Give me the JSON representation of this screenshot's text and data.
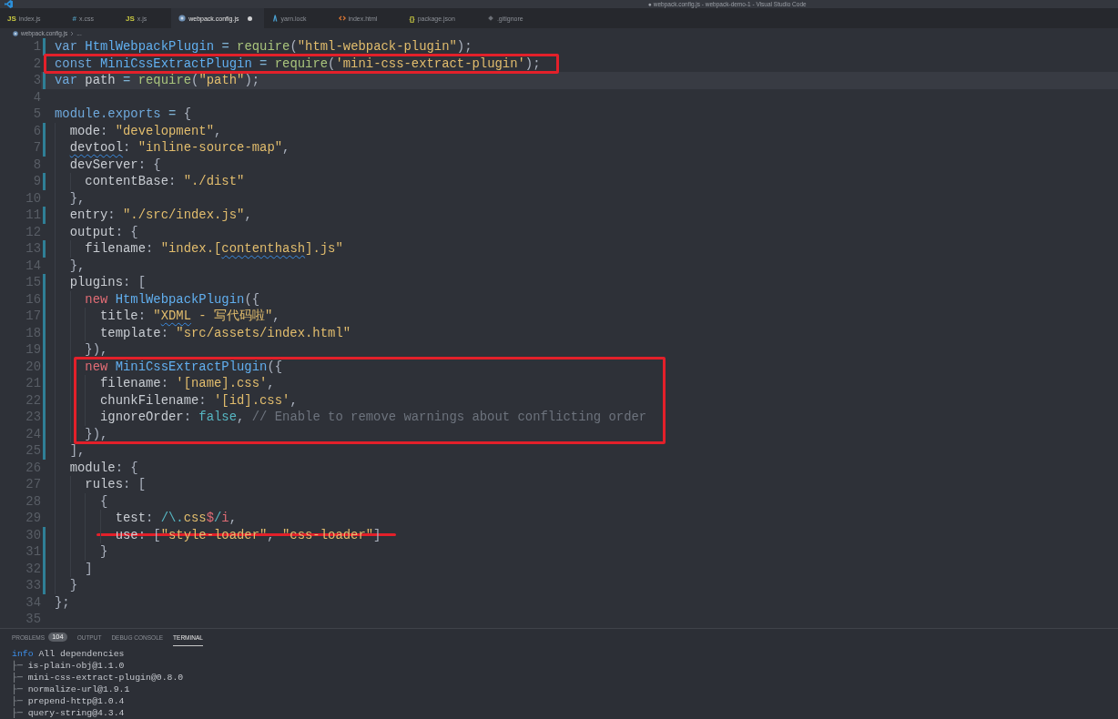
{
  "window": {
    "title": "● webpack.config.js - webpack-demo-1 - Visual Studio Code"
  },
  "tabs": [
    {
      "label": "index.js",
      "kind": "js",
      "glyph": "JS",
      "selected": false,
      "modified": false
    },
    {
      "label": "x.css",
      "kind": "css",
      "glyph": "#",
      "selected": false,
      "modified": false
    },
    {
      "label": "x.js",
      "kind": "js",
      "glyph": "JS",
      "selected": false,
      "modified": false
    },
    {
      "label": "webpack.config.js",
      "kind": "config",
      "selected": true,
      "modified": true
    },
    {
      "label": "yarn.lock",
      "kind": "yarn",
      "selected": false,
      "modified": false
    },
    {
      "label": "index.html",
      "kind": "html",
      "selected": false,
      "modified": false
    },
    {
      "label": "package.json",
      "kind": "json",
      "glyph": "{}",
      "selected": false,
      "modified": false
    },
    {
      "label": ".gitignore",
      "kind": "git",
      "selected": false,
      "modified": false
    }
  ],
  "breadcrumb": {
    "kind": "config",
    "items": [
      "webpack.config.js",
      "..."
    ]
  },
  "lines": [
    {
      "n": "1",
      "changed": true,
      "current": false,
      "boxed": false,
      "struck": false,
      "code": [
        {
          "text": "var ",
          "kind": "decl"
        },
        {
          "text": "HtmlWebpackPlugin",
          "kind": "class"
        },
        {
          "text": " = ",
          "kind": "op"
        },
        {
          "text": "require",
          "kind": "fn"
        },
        {
          "text": "(",
          "kind": "punc"
        },
        {
          "text": "\"html-webpack-plugin\"",
          "kind": "str"
        },
        {
          "text": ");",
          "kind": "punc"
        }
      ]
    },
    {
      "n": "2",
      "changed": false,
      "current": false,
      "boxed": true,
      "struck": false,
      "code": [
        {
          "text": "const ",
          "kind": "decl"
        },
        {
          "text": "MiniCssExtractPlugin",
          "kind": "class"
        },
        {
          "text": " = ",
          "kind": "op"
        },
        {
          "text": "require",
          "kind": "fn"
        },
        {
          "text": "(",
          "kind": "punc"
        },
        {
          "text": "'mini-css-extract-plugin'",
          "kind": "str"
        },
        {
          "text": ");",
          "kind": "punc"
        }
      ]
    },
    {
      "n": "3",
      "changed": true,
      "current": true,
      "boxed": false,
      "struck": false,
      "code": [
        {
          "text": "var ",
          "kind": "decl"
        },
        {
          "text": "path",
          "kind": "plain"
        },
        {
          "text": " = ",
          "kind": "op"
        },
        {
          "text": "require",
          "kind": "fn"
        },
        {
          "text": "(",
          "kind": "punc"
        },
        {
          "text": "\"path\"",
          "kind": "str"
        },
        {
          "text": ");",
          "kind": "punc"
        }
      ]
    },
    {
      "n": "4",
      "changed": false,
      "current": false,
      "boxed": false,
      "struck": false
    },
    {
      "n": "5",
      "changed": false,
      "current": false,
      "boxed": false,
      "struck": false,
      "code": [
        {
          "text": "module.exports",
          "kind": "obj"
        },
        {
          "text": " = ",
          "kind": "op"
        },
        {
          "text": "{",
          "kind": "punc"
        }
      ]
    },
    {
      "n": "6",
      "changed": true,
      "current": false,
      "boxed": false,
      "struck": false,
      "code": [
        {
          "text": "  mode",
          "kind": "prop"
        },
        {
          "text": ": ",
          "kind": "punc"
        },
        {
          "text": "\"development\"",
          "kind": "str"
        },
        {
          "text": ",",
          "kind": "punc"
        }
      ]
    },
    {
      "n": "7",
      "changed": true,
      "current": false,
      "boxed": false,
      "struck": false,
      "code": [
        {
          "text": "  devtool",
          "kind": "prop",
          "squiggle": true
        },
        {
          "text": ": ",
          "kind": "punc"
        },
        {
          "text": "\"inline-source-map\"",
          "kind": "str"
        },
        {
          "text": ",",
          "kind": "punc"
        }
      ]
    },
    {
      "n": "8",
      "changed": false,
      "current": false,
      "boxed": false,
      "struck": false,
      "code": [
        {
          "text": "  devServer",
          "kind": "prop"
        },
        {
          "text": ": {",
          "kind": "punc"
        }
      ]
    },
    {
      "n": "9",
      "changed": true,
      "current": false,
      "boxed": false,
      "struck": false,
      "code": [
        {
          "text": "    contentBase",
          "kind": "prop"
        },
        {
          "text": ": ",
          "kind": "punc"
        },
        {
          "text": "\"./dist\"",
          "kind": "str"
        }
      ]
    },
    {
      "n": "10",
      "changed": false,
      "current": false,
      "boxed": false,
      "struck": false,
      "code": [
        {
          "text": "  },",
          "kind": "punc"
        }
      ]
    },
    {
      "n": "11",
      "changed": true,
      "current": false,
      "boxed": false,
      "struck": false,
      "code": [
        {
          "text": "  entry",
          "kind": "prop"
        },
        {
          "text": ": ",
          "kind": "punc"
        },
        {
          "text": "\"./src/index.js\"",
          "kind": "str"
        },
        {
          "text": ",",
          "kind": "punc"
        }
      ]
    },
    {
      "n": "12",
      "changed": false,
      "current": false,
      "boxed": false,
      "struck": false,
      "code": [
        {
          "text": "  output",
          "kind": "prop"
        },
        {
          "text": ": {",
          "kind": "punc"
        }
      ]
    },
    {
      "n": "13",
      "changed": true,
      "current": false,
      "boxed": false,
      "struck": false,
      "code": [
        {
          "text": "    filename",
          "kind": "prop"
        },
        {
          "text": ": ",
          "kind": "punc"
        },
        {
          "text": "\"index.[",
          "kind": "str"
        },
        {
          "text": "contenthash",
          "kind": "str",
          "squiggle": true
        },
        {
          "text": "].js\"",
          "kind": "str"
        }
      ]
    },
    {
      "n": "14",
      "changed": false,
      "current": false,
      "boxed": false,
      "struck": false,
      "code": [
        {
          "text": "  },",
          "kind": "punc"
        }
      ]
    },
    {
      "n": "15",
      "changed": true,
      "current": false,
      "boxed": false,
      "struck": false,
      "code": [
        {
          "text": "  plugins",
          "kind": "prop"
        },
        {
          "text": ": [",
          "kind": "punc"
        }
      ]
    },
    {
      "n": "16",
      "changed": true,
      "current": false,
      "boxed": false,
      "struck": false,
      "code": [
        {
          "text": "    new ",
          "kind": "new"
        },
        {
          "text": "HtmlWebpackPlugin",
          "kind": "class"
        },
        {
          "text": "({",
          "kind": "punc"
        }
      ]
    },
    {
      "n": "17",
      "changed": true,
      "current": false,
      "boxed": false,
      "struck": false,
      "code": [
        {
          "text": "      title",
          "kind": "prop"
        },
        {
          "text": ": ",
          "kind": "punc"
        },
        {
          "text": "\"",
          "kind": "str"
        },
        {
          "text": "XDML",
          "kind": "str",
          "squiggle": true
        },
        {
          "text": " - 写代码啦\"",
          "kind": "str"
        },
        {
          "text": ",",
          "kind": "punc"
        }
      ]
    },
    {
      "n": "18",
      "changed": true,
      "current": false,
      "boxed": false,
      "struck": false,
      "code": [
        {
          "text": "      template",
          "kind": "prop"
        },
        {
          "text": ": ",
          "kind": "punc"
        },
        {
          "text": "\"src/assets/index.html\"",
          "kind": "str"
        }
      ]
    },
    {
      "n": "19",
      "changed": true,
      "current": false,
      "boxed": false,
      "struck": false,
      "code": [
        {
          "text": "    }),",
          "kind": "punc"
        }
      ]
    },
    {
      "n": "20",
      "changed": true,
      "current": false,
      "boxed": true,
      "struck": false,
      "code": [
        {
          "text": "    new ",
          "kind": "new"
        },
        {
          "text": "MiniCssExtractPlugin",
          "kind": "class"
        },
        {
          "text": "({",
          "kind": "punc"
        }
      ]
    },
    {
      "n": "21",
      "changed": true,
      "current": false,
      "boxed": true,
      "struck": false,
      "code": [
        {
          "text": "      filename",
          "kind": "prop"
        },
        {
          "text": ": ",
          "kind": "punc"
        },
        {
          "text": "'[name].css'",
          "kind": "str"
        },
        {
          "text": ",",
          "kind": "punc"
        }
      ]
    },
    {
      "n": "22",
      "changed": true,
      "current": false,
      "boxed": true,
      "struck": false,
      "code": [
        {
          "text": "      chunkFilename",
          "kind": "prop"
        },
        {
          "text": ": ",
          "kind": "punc"
        },
        {
          "text": "'[id].css'",
          "kind": "str"
        },
        {
          "text": ",",
          "kind": "punc"
        }
      ]
    },
    {
      "n": "23",
      "changed": true,
      "current": false,
      "boxed": true,
      "struck": false,
      "code": [
        {
          "text": "      ignoreOrder",
          "kind": "prop"
        },
        {
          "text": ": ",
          "kind": "punc"
        },
        {
          "text": "false",
          "kind": "bool"
        },
        {
          "text": ", ",
          "kind": "punc"
        },
        {
          "text": "// Enable to remove warnings about conflicting order",
          "kind": "comment"
        }
      ]
    },
    {
      "n": "24",
      "changed": true,
      "current": false,
      "boxed": true,
      "struck": false,
      "code": [
        {
          "text": "    }),",
          "kind": "punc"
        }
      ]
    },
    {
      "n": "25",
      "changed": true,
      "current": false,
      "boxed": false,
      "struck": false,
      "code": [
        {
          "text": "  ],",
          "kind": "punc"
        }
      ]
    },
    {
      "n": "26",
      "changed": false,
      "current": false,
      "boxed": false,
      "struck": false,
      "code": [
        {
          "text": "  module",
          "kind": "prop"
        },
        {
          "text": ": {",
          "kind": "punc"
        }
      ]
    },
    {
      "n": "27",
      "changed": false,
      "current": false,
      "boxed": false,
      "struck": false,
      "code": [
        {
          "text": "    rules",
          "kind": "prop"
        },
        {
          "text": ": [",
          "kind": "punc"
        }
      ]
    },
    {
      "n": "28",
      "changed": false,
      "current": false,
      "boxed": false,
      "struck": false,
      "code": [
        {
          "text": "      {",
          "kind": "punc"
        }
      ]
    },
    {
      "n": "29",
      "changed": false,
      "current": false,
      "boxed": false,
      "struck": false,
      "code": [
        {
          "text": "        test",
          "kind": "prop"
        },
        {
          "text": ": ",
          "kind": "punc"
        },
        {
          "text": "/\\.",
          "kind": "re"
        },
        {
          "text": "css",
          "kind": "str"
        },
        {
          "text": "$",
          "kind": "reflag"
        },
        {
          "text": "/",
          "kind": "re"
        },
        {
          "text": "i",
          "kind": "reflag"
        },
        {
          "text": ",",
          "kind": "punc"
        }
      ]
    },
    {
      "n": "30",
      "changed": true,
      "current": false,
      "boxed": false,
      "struck": true,
      "code": [
        {
          "text": "        use",
          "kind": "prop"
        },
        {
          "text": ": [",
          "kind": "punc"
        },
        {
          "text": "\"style-loader\"",
          "kind": "str"
        },
        {
          "text": ", ",
          "kind": "punc"
        },
        {
          "text": "\"css-loader\"",
          "kind": "str"
        },
        {
          "text": "]",
          "kind": "punc"
        }
      ]
    },
    {
      "n": "31",
      "changed": true,
      "current": false,
      "boxed": false,
      "struck": false,
      "code": [
        {
          "text": "      }",
          "kind": "punc"
        }
      ]
    },
    {
      "n": "32",
      "changed": true,
      "current": false,
      "boxed": false,
      "struck": false,
      "code": [
        {
          "text": "    ]",
          "kind": "punc"
        }
      ]
    },
    {
      "n": "33",
      "changed": true,
      "current": false,
      "boxed": false,
      "struck": false,
      "code": [
        {
          "text": "  }",
          "kind": "punc"
        }
      ]
    },
    {
      "n": "34",
      "changed": false,
      "current": false,
      "boxed": false,
      "struck": false,
      "code": [
        {
          "text": "};",
          "kind": "punc"
        }
      ]
    },
    {
      "n": "35",
      "changed": false,
      "current": false,
      "boxed": false,
      "struck": false
    }
  ],
  "panel": {
    "tabs": [
      {
        "label": "PROBLEMS",
        "badge": "104",
        "selected": false
      },
      {
        "label": "OUTPUT",
        "selected": false
      },
      {
        "label": "DEBUG CONSOLE",
        "selected": false
      },
      {
        "label": "TERMINAL",
        "selected": true
      }
    ],
    "terminal": [
      {
        "kind": "info",
        "prefix": "info",
        "text": "All dependencies"
      },
      {
        "kind": "tree",
        "prefix": "├─",
        "text": "is-plain-obj@1.1.0"
      },
      {
        "kind": "tree",
        "prefix": "├─",
        "text": "mini-css-extract-plugin@0.8.0"
      },
      {
        "kind": "tree",
        "prefix": "├─",
        "text": "normalize-url@1.9.1"
      },
      {
        "kind": "tree",
        "prefix": "├─",
        "text": "prepend-http@1.0.4"
      },
      {
        "kind": "tree",
        "prefix": "├─",
        "text": "query-string@4.3.4"
      }
    ]
  }
}
